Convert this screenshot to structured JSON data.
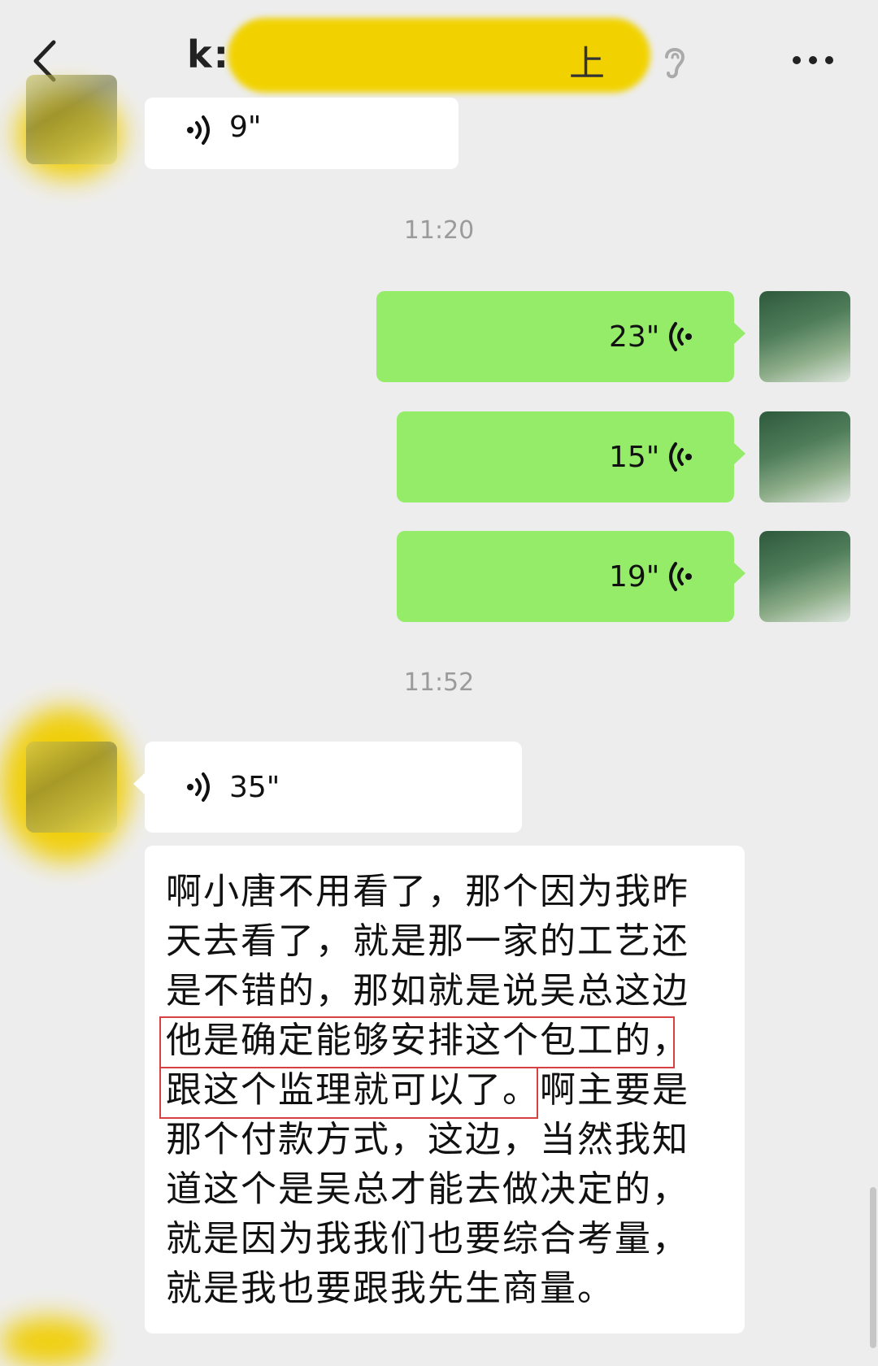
{
  "header": {
    "title_prefix": "k:",
    "title_visible_tail": "上",
    "back_icon": "chevron-left-icon",
    "ear_icon": "ear-icon",
    "more_icon": "more-dots-icon"
  },
  "colors": {
    "background": "#ededed",
    "bubble_self": "#95ec69",
    "bubble_other": "#ffffff",
    "timestamp": "#9b9b9b",
    "highlight_border": "#d64141",
    "redaction": "#f0cd00"
  },
  "messages": {
    "top_partial": {
      "duration": "9\""
    },
    "time1": "11:20",
    "self_voice_1": {
      "duration": "23\""
    },
    "self_voice_2": {
      "duration": "15\""
    },
    "self_voice_3": {
      "duration": "19\""
    },
    "time2": "11:52",
    "other_voice": {
      "duration": "35\""
    },
    "transcript": {
      "line1": "啊小唐不用看了，那个因为我昨",
      "line2": "天去看了，就是那一家的工艺还",
      "line3": "是不错的，那如就是说吴总这边",
      "line4": "他是确定能够安排这个包工的，",
      "line5a": "跟这个监理就可以了。",
      "line5b": "啊主要是",
      "line6": "那个付款方式，这边，当然我知",
      "line7": "道这个是吴总才能去做决定的，",
      "line8": "就是因为我我们也要综合考量，",
      "line9": "就是我也要跟我先生商量。"
    }
  }
}
